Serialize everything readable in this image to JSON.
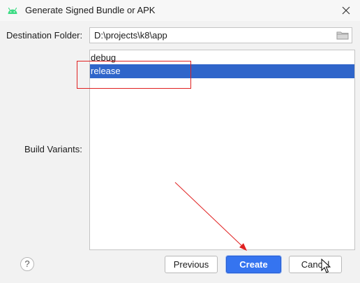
{
  "window": {
    "title": "Generate Signed Bundle or APK",
    "icon": "android-icon",
    "close_icon": "close-icon"
  },
  "form": {
    "destination_label": "Destination Folder:",
    "destination_value": "D:\\projects\\k8\\app",
    "browse_icon": "folder-icon",
    "build_variants_label": "Build Variants:",
    "variants": [
      {
        "label": "debug",
        "selected": false
      },
      {
        "label": "release",
        "selected": true
      }
    ]
  },
  "footer": {
    "help_label": "?",
    "previous_label": "Previous",
    "create_label": "Create",
    "cancel_label": "Cancel"
  },
  "colors": {
    "selection": "#2f65ca",
    "primary_button": "#3574f0",
    "annotation": "#e02020",
    "android_green": "#3ddc84"
  }
}
